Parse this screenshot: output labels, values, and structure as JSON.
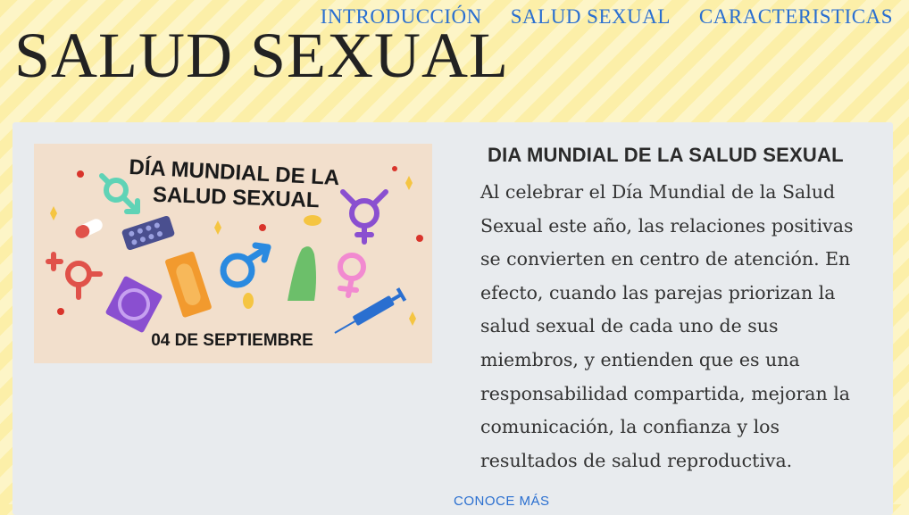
{
  "header": {
    "site_title": "SALUD SEXUAL",
    "nav": [
      {
        "label": "INTRODUCCIÓN"
      },
      {
        "label": "SALUD SEXUAL"
      },
      {
        "label": "CARACTERISTICAS"
      }
    ]
  },
  "article": {
    "banner": {
      "title_line1": "DÍA MUNDIAL DE LA",
      "title_line2": "SALUD SEXUAL",
      "date": "04 DE SEPTIEMBRE"
    },
    "heading": "DIA MUNDIAL DE LA SALUD SEXUAL",
    "body": "Al celebrar el Día Mundial de la Salud Sexual este año, las relaciones positivas se convierten en centro de atención. En efecto, cuando las parejas priorizan la salud sexual de cada uno de sus miembros, y entienden que es una responsabilidad compartida, mejoran la comunicación, la confianza y los resultados de salud reproductiva.",
    "more_link": "CONOCE MÁS"
  },
  "colors": {
    "link": "#2a6fd0",
    "banner_bg": "#f2dfcc",
    "teal": "#5fd3b6",
    "purple": "#8a4fd0",
    "blue": "#2a8ae0",
    "pink": "#f28ad0",
    "red": "#e0524a",
    "orange": "#f29a2e",
    "green": "#6cbf6a",
    "yellow": "#f5c542"
  }
}
